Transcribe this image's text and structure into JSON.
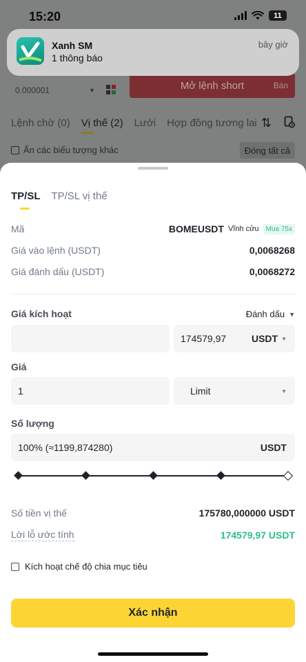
{
  "status_bar": {
    "time": "15:20",
    "battery": "11"
  },
  "notification": {
    "app": "Xanh SM",
    "message": "1 thông báo",
    "time": "bây giờ"
  },
  "background": {
    "price_value": "0.000001",
    "short_button": "Mở lệnh short",
    "short_sub": "Bán",
    "tabs": [
      "Lệnh chờ (0)",
      "Vị thế (2)",
      "Lưới",
      "Hợp đồng tương lai"
    ],
    "hide_icons": "Ẩn các biểu tượng khác",
    "close_all": "Đóng tất cả"
  },
  "sheet": {
    "tabs": [
      {
        "label": "TP/SL"
      },
      {
        "label": "TP/SL vị thế"
      }
    ],
    "symbol_label": "Mã",
    "symbol": "BOMEUSDT",
    "contract": "Vĩnh cửu",
    "leverage": "Mua 75x",
    "entry_label": "Giá vào lệnh (USDT)",
    "entry_value": "0,0068268",
    "mark_label": "Giá đánh dấu (USDT)",
    "mark_value": "0,0068272",
    "trigger_label": "Giá kích hoạt",
    "trigger_type": "Đánh dấu",
    "trigger_value": "174579,97",
    "trigger_unit": "USDT",
    "price_label": "Giá",
    "price_value": "1",
    "order_type": "Limit",
    "qty_label": "Số lượng",
    "qty_value": "100% (≈1199,874280)",
    "qty_unit": "USDT",
    "slider_value": 100,
    "position_label": "Số tiền vị thế",
    "position_value": "175780,000000 USDT",
    "pnl_label": "Lời lỗ ước tính",
    "pnl_value": "174579,97 USDT",
    "split_label": "Kích hoạt chế độ chia mục tiêu",
    "confirm": "Xác nhận"
  }
}
